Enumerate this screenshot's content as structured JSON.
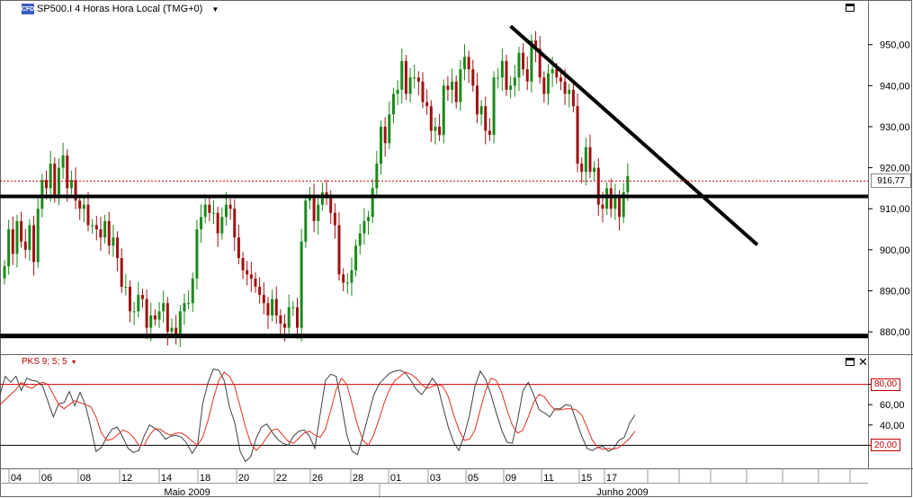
{
  "header": {
    "symbol_badge": "CFD",
    "title": "SP500.I 4 Horas Hora Local (TMG+0)"
  },
  "indicator": {
    "label": "PKS 9; 5; 5",
    "upper_level": "80,00",
    "lower_level": "20,00"
  },
  "last_price_label": "916,77",
  "colors": {
    "up_candle": "#1a8a1a",
    "down_candle": "#a01010",
    "k_line": "#404040",
    "d_line": "#e03020",
    "last_price_line": "#cc0000",
    "level_line": "#cc0000"
  },
  "chart_data": [
    {
      "type": "candlestick",
      "title": "SP500.I 4 Horas Hora Local (TMG+0)",
      "ylim": [
        875,
        960
      ],
      "y_ticks": [
        "950,00",
        "940,00",
        "930,00",
        "920,00",
        "910,00",
        "900,00",
        "890,00",
        "880,00"
      ],
      "y_tick_values": [
        950,
        940,
        930,
        920,
        910,
        900,
        890,
        880
      ],
      "last_price": 916.77,
      "series_close": [
        896,
        905,
        899,
        907,
        902,
        900,
        906,
        897,
        910,
        917,
        915,
        921,
        913,
        920,
        923,
        915,
        917,
        912,
        910,
        911,
        906,
        906,
        905,
        903,
        907,
        901,
        903,
        898,
        891,
        891,
        885,
        885,
        889,
        888,
        881,
        884,
        883,
        885,
        887,
        880,
        881,
        879,
        885,
        887,
        887,
        893,
        905,
        908,
        911,
        909,
        909,
        904,
        908,
        911,
        910,
        903,
        898,
        895,
        894,
        893,
        891,
        889,
        887,
        884,
        888,
        884,
        882,
        881,
        886,
        886,
        881,
        902,
        912,
        913,
        907,
        911,
        914,
        913,
        909,
        906,
        894,
        892,
        892,
        895,
        901,
        904,
        907,
        908,
        915,
        921,
        930,
        926,
        933,
        938,
        939,
        946,
        938,
        942,
        942,
        941,
        936,
        935,
        929,
        930,
        928,
        940,
        939,
        941,
        936,
        944,
        947,
        944,
        940,
        933,
        935,
        929,
        928,
        942,
        942,
        946,
        939,
        940,
        942,
        948,
        944,
        941,
        951,
        949,
        942,
        938,
        943,
        944,
        942,
        941,
        938,
        939,
        935,
        921,
        919,
        925,
        919,
        920,
        911,
        910,
        915,
        910,
        913,
        908,
        914,
        918
      ],
      "horizontal_lines": [
        913,
        879
      ],
      "trend_line": {
        "from": {
          "bar": 121,
          "price": 954.5
        },
        "to": {
          "bar": 180,
          "price": 901.2
        }
      }
    },
    {
      "type": "line",
      "title": "PKS 9; 5; 5",
      "ylim": [
        0,
        100
      ],
      "y_ticks": [
        "80,00",
        "60,00",
        "40,00",
        "20,00"
      ],
      "y_tick_values": [
        80,
        60,
        40,
        20
      ],
      "reference_levels": [
        80,
        20
      ],
      "series": [
        {
          "name": "%K",
          "values": [
            70,
            88,
            82,
            88,
            74,
            86,
            84,
            83,
            78,
            63,
            48,
            61,
            62,
            73,
            59,
            72,
            60,
            38,
            14,
            18,
            28,
            36,
            38,
            28,
            17,
            13,
            15,
            29,
            40,
            37,
            33,
            26,
            29,
            30,
            28,
            22,
            12,
            20,
            61,
            82,
            95,
            94,
            84,
            58,
            42,
            14,
            4,
            9,
            27,
            38,
            41,
            33,
            26,
            22,
            20,
            29,
            34,
            35,
            29,
            17,
            51,
            84,
            90,
            88,
            60,
            30,
            14,
            11,
            29,
            49,
            69,
            80,
            86,
            91,
            93,
            94,
            91,
            84,
            75,
            70,
            77,
            86,
            79,
            58,
            38,
            23,
            15,
            30,
            50,
            78,
            93,
            85,
            70,
            52,
            35,
            23,
            22,
            45,
            74,
            82,
            70,
            55,
            52,
            48,
            56,
            56,
            60,
            59,
            44,
            29,
            17,
            15,
            18,
            19,
            14,
            17,
            25,
            28,
            42,
            50
          ]
        },
        {
          "name": "%D",
          "values": [
            60,
            65,
            70,
            75,
            82,
            78,
            76,
            80,
            82,
            80,
            70,
            60,
            56,
            60,
            64,
            62,
            60,
            58,
            48,
            32,
            25,
            26,
            30,
            35,
            33,
            28,
            20,
            20,
            30,
            36,
            36,
            32,
            30,
            32,
            32,
            29,
            24,
            20,
            28,
            45,
            66,
            84,
            92,
            88,
            78,
            58,
            38,
            22,
            15,
            20,
            28,
            35,
            36,
            30,
            24,
            22,
            27,
            32,
            34,
            30,
            28,
            36,
            55,
            75,
            86,
            80,
            60,
            40,
            25,
            20,
            30,
            45,
            62,
            75,
            84,
            88,
            92,
            90,
            86,
            80,
            76,
            78,
            80,
            78,
            68,
            50,
            35,
            25,
            26,
            35,
            55,
            74,
            86,
            84,
            72,
            55,
            40,
            32,
            35,
            48,
            62,
            70,
            68,
            60,
            55,
            55,
            56,
            56,
            55,
            50,
            38,
            25,
            18,
            16,
            17,
            16,
            18,
            22,
            27,
            34
          ]
        }
      ]
    }
  ],
  "x_axis": {
    "ticks": [
      "04",
      "06",
      "08",
      "12",
      "14",
      "18",
      "20",
      "22",
      "26",
      "28",
      "01",
      "03",
      "05",
      "09",
      "11",
      "15",
      "17"
    ],
    "months": [
      "Maio 2009",
      "Junho 2009"
    ]
  }
}
